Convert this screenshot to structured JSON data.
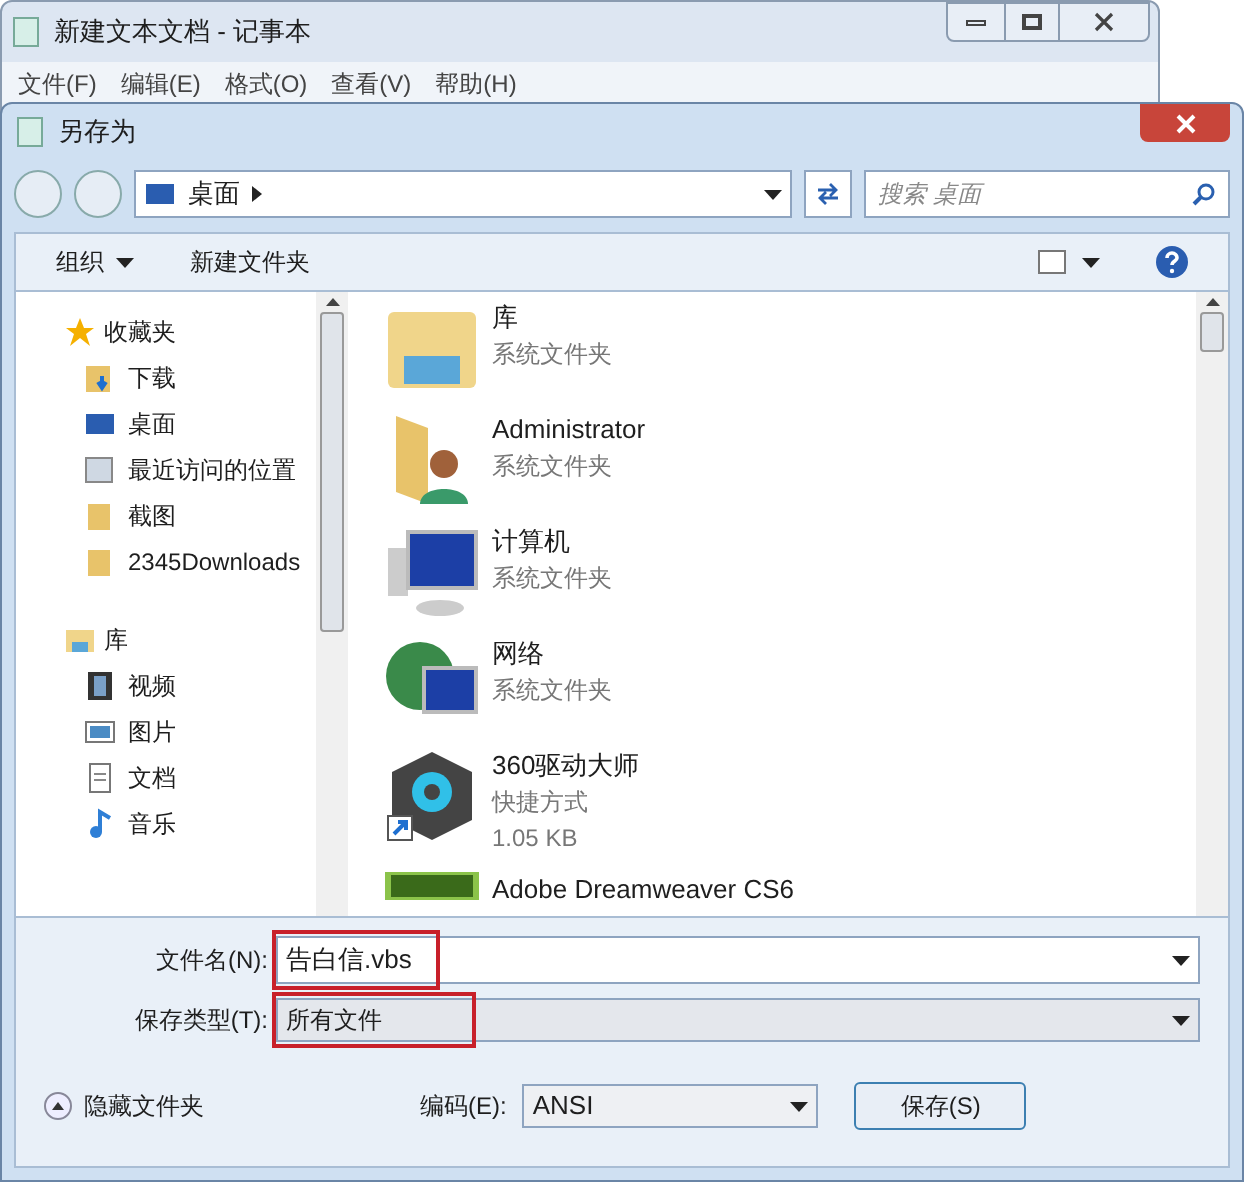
{
  "notepad": {
    "title": "新建文本文档 - 记事本",
    "menu": [
      "文件(F)",
      "编辑(E)",
      "格式(O)",
      "查看(V)",
      "帮助(H)"
    ]
  },
  "dialog": {
    "title": "另存为",
    "address": "桌面",
    "search": {
      "placeholder": "搜索 桌面"
    },
    "toolbar": [
      "组织",
      "新建文件夹"
    ],
    "sidebar": [
      {
        "label": "收藏夹",
        "kind": "star",
        "children": [
          {
            "label": "下载",
            "kind": "download"
          },
          {
            "label": "桌面",
            "kind": "desktop"
          },
          {
            "label": "最近访问的位置",
            "kind": "recent"
          },
          {
            "label": "截图",
            "kind": "folder"
          },
          {
            "label": "2345Downloads",
            "kind": "folder"
          }
        ]
      },
      {
        "label": "库",
        "kind": "library",
        "children": [
          {
            "label": "视频",
            "kind": "video"
          },
          {
            "label": "图片",
            "kind": "picture"
          },
          {
            "label": "文档",
            "kind": "document"
          },
          {
            "label": "音乐",
            "kind": "music"
          }
        ]
      }
    ],
    "files": [
      {
        "name": "库",
        "lines": [
          "系统文件夹"
        ],
        "kind": "library"
      },
      {
        "name": "Administrator",
        "lines": [
          "系统文件夹"
        ],
        "kind": "user"
      },
      {
        "name": "计算机",
        "lines": [
          "系统文件夹"
        ],
        "kind": "computer"
      },
      {
        "name": "网络",
        "lines": [
          "系统文件夹"
        ],
        "kind": "network"
      },
      {
        "name": "360驱动大师",
        "lines": [
          "快捷方式",
          "1.05 KB"
        ],
        "kind": "shortcut"
      },
      {
        "name": "Adobe Dreamweaver CS6",
        "kind": "app"
      }
    ],
    "filename": {
      "label": "文件名(N):",
      "value": "告白信.vbs"
    },
    "filetype": {
      "label": "保存类型(T):",
      "value": "所有文件"
    },
    "hide_folders": "隐藏文件夹",
    "encoding": {
      "label": "编码(E):",
      "value": "ANSI"
    },
    "save": "保存(S)"
  }
}
